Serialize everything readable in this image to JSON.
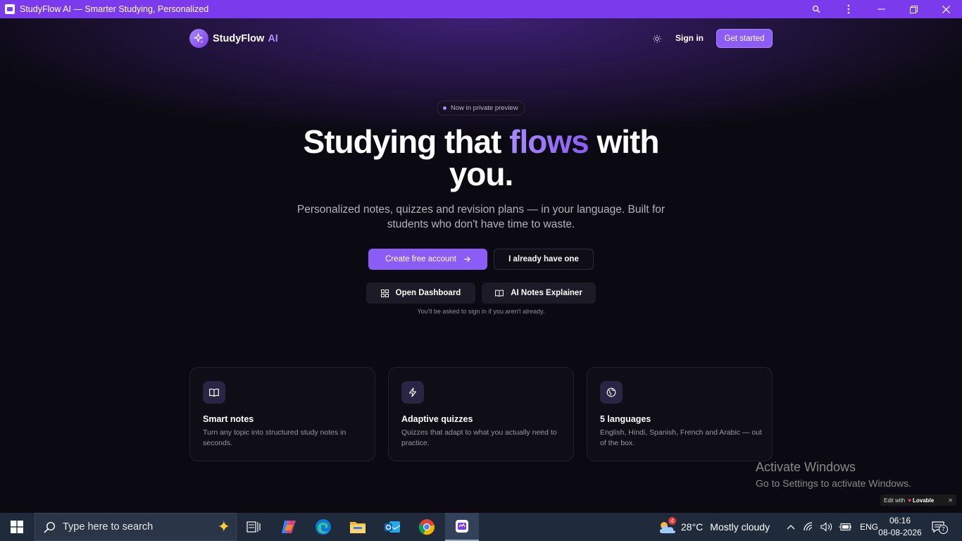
{
  "window": {
    "title": "StudyFlow AI — Smarter Studying, Personalized"
  },
  "nav": {
    "brand_name": "StudyFlow",
    "brand_suffix": "AI",
    "signin_label": "Sign in",
    "get_started_label": "Get started"
  },
  "hero": {
    "badge": "Now in private preview",
    "title_part1": "Studying that ",
    "title_accent": "flows",
    "title_part2": " with you.",
    "subtitle": "Personalized notes, quizzes and revision plans — in your language. Built for students who don't have time to waste.",
    "primary_cta": "Create free account",
    "secondary_cta": "I already have one",
    "dashboard_btn": "Open Dashboard",
    "explainer_btn": "AI Notes Explainer",
    "hint": "You'll be asked to sign in if you aren't already."
  },
  "features": [
    {
      "icon": "book-icon",
      "title": "Smart notes",
      "desc": "Turn any topic into structured study notes in seconds."
    },
    {
      "icon": "lightning-icon",
      "title": "Adaptive quizzes",
      "desc": "Quizzes that adapt to what you actually need to practice."
    },
    {
      "icon": "globe-icon",
      "title": "5 languages",
      "desc": "English, Hindi, Spanish, French and Arabic — out of the box."
    }
  ],
  "overlay": {
    "activate_title": "Activate Windows",
    "activate_sub": "Go to Settings to activate Windows.",
    "lovable_prefix": "Edit with",
    "lovable_name": "Lovable"
  },
  "taskbar": {
    "search_placeholder": "Type here to search",
    "weather_badge": "4",
    "temperature": "28°C",
    "weather": "Mostly cloudy",
    "language": "ENG",
    "time": "06:16",
    "date": "08-08-2026",
    "notification_count": "7"
  },
  "colors": {
    "accent": "#8b5cf6",
    "accent_light": "#a78bfa",
    "background": "#0b0a12",
    "titlebar": "#7c3aed"
  }
}
